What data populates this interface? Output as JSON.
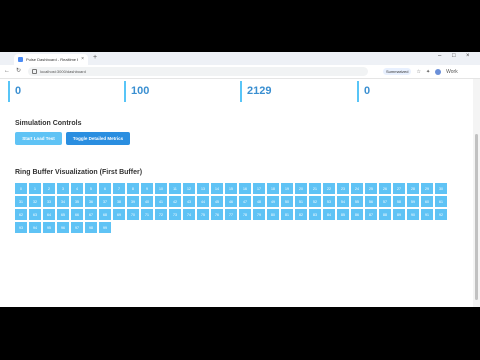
{
  "browser": {
    "tab_title": "Pulse Dashboard - Realtime Buffer Dem",
    "url": "localhost:3000/dashboard",
    "summarized_label": "Summarized",
    "profile_label": "Work"
  },
  "stats": [
    {
      "value": "0"
    },
    {
      "value": "100"
    },
    {
      "value": "2129"
    },
    {
      "value": "0"
    }
  ],
  "controls": {
    "heading": "Simulation Controls",
    "start_label": "Start Load Test",
    "toggle_label": "Toggle Detailed Metrics"
  },
  "ring": {
    "heading": "Ring Buffer Visualization (First Buffer)",
    "cells": [
      "0",
      "1",
      "2",
      "3",
      "4",
      "5",
      "6",
      "7",
      "8",
      "9",
      "10",
      "11",
      "12",
      "13",
      "14",
      "15",
      "16",
      "17",
      "18",
      "19",
      "20",
      "21",
      "22",
      "23",
      "24",
      "25",
      "26",
      "27",
      "28",
      "29",
      "30",
      "31",
      "32",
      "33",
      "34",
      "35",
      "36",
      "37",
      "38",
      "39",
      "40",
      "41",
      "42",
      "43",
      "44",
      "45",
      "46",
      "47",
      "48",
      "49",
      "50",
      "51",
      "52",
      "53",
      "54",
      "55",
      "56",
      "57",
      "58",
      "59",
      "60",
      "61",
      "62",
      "63",
      "64",
      "65",
      "66",
      "67",
      "68",
      "69",
      "70",
      "71",
      "72",
      "73",
      "74",
      "75",
      "76",
      "77",
      "78",
      "79",
      "80",
      "81",
      "82",
      "83",
      "84",
      "85",
      "86",
      "87",
      "88",
      "89",
      "90",
      "91",
      "92",
      "93",
      "94",
      "95",
      "96",
      "97",
      "98",
      "99"
    ]
  },
  "colors": {
    "accent": "#58c5f7",
    "stat_text": "#3a8fd1",
    "button": "#5fc3f5"
  }
}
